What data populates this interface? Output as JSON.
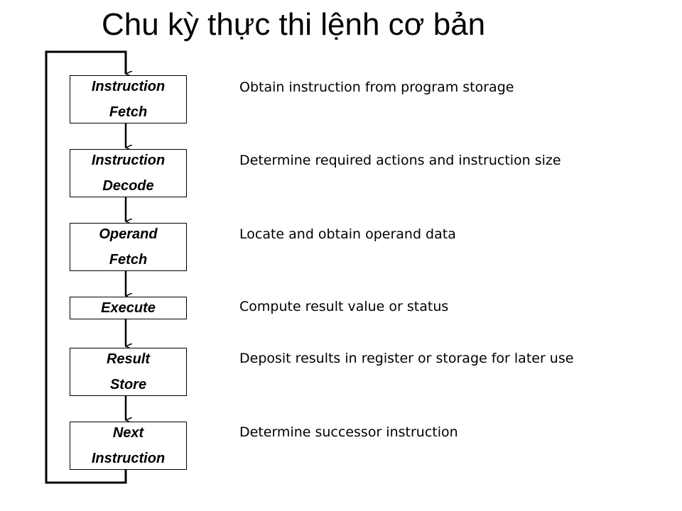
{
  "title": "Chu kỳ thực thi lệnh cơ bản",
  "steps": [
    {
      "line1": "Instruction",
      "line2": "Fetch",
      "description": "Obtain instruction from program storage"
    },
    {
      "line1": "Instruction",
      "line2": "Decode",
      "description": "Determine required actions and instruction size"
    },
    {
      "line1": "Operand",
      "line2": "Fetch",
      "description": "Locate and obtain operand data"
    },
    {
      "line1": "Execute",
      "line2": "",
      "description": "Compute result value or status"
    },
    {
      "line1": "Result",
      "line2": "Store",
      "description": "Deposit results in register or storage for later use"
    },
    {
      "line1": "Next",
      "line2": "Instruction",
      "description": "Determine successor instruction"
    }
  ]
}
